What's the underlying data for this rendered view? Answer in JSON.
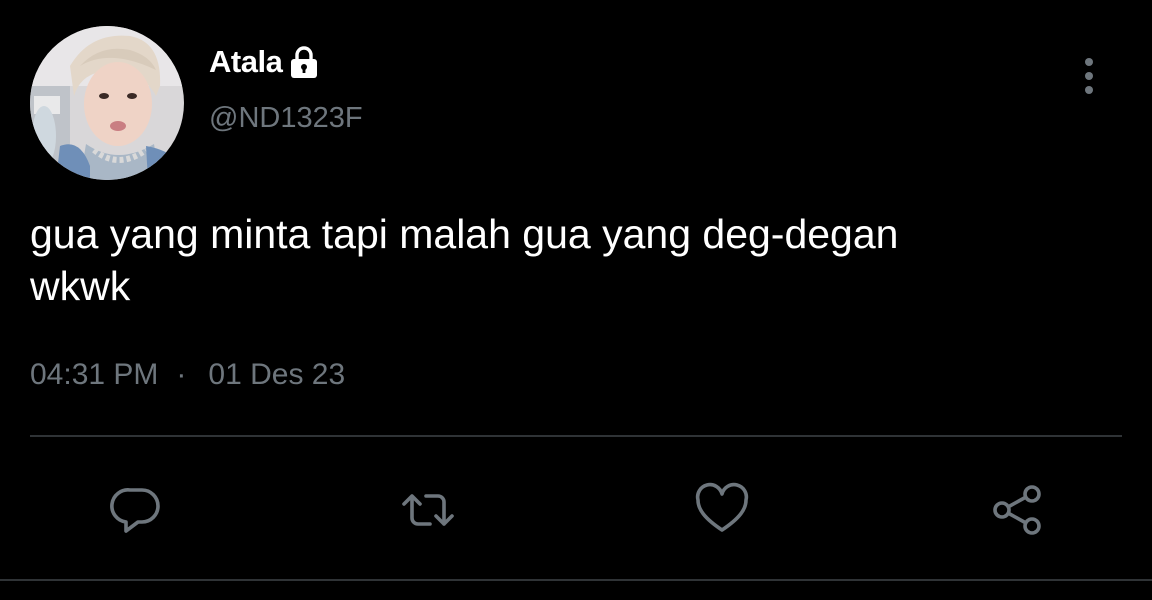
{
  "tweet": {
    "author": {
      "display_name": "Atala",
      "handle": "@ND1323F",
      "protected_icon": "lock-icon",
      "avatar": "profile-photo"
    },
    "text": "gua yang minta tapi malah gua yang deg-degan\nwkwk",
    "time": "04:31 PM",
    "separator": "·",
    "date": "01 Des 23"
  },
  "actions": [
    {
      "name": "reply",
      "icon": "reply-icon"
    },
    {
      "name": "retweet",
      "icon": "retweet-icon"
    },
    {
      "name": "like",
      "icon": "heart-icon"
    },
    {
      "name": "share",
      "icon": "share-icon"
    }
  ],
  "menu_icon": "more-options-icon",
  "colors": {
    "background": "#000000",
    "text": "#ffffff",
    "secondary_text": "#6e767d",
    "divider": "#2f3336"
  }
}
